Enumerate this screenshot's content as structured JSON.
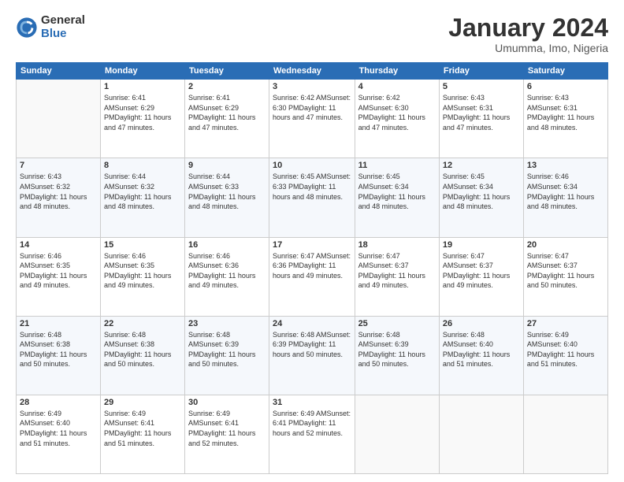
{
  "logo": {
    "general": "General",
    "blue": "Blue"
  },
  "title": {
    "month": "January 2024",
    "location": "Umumma, Imo, Nigeria"
  },
  "weekdays": [
    "Sunday",
    "Monday",
    "Tuesday",
    "Wednesday",
    "Thursday",
    "Friday",
    "Saturday"
  ],
  "weeks": [
    [
      {
        "day": "",
        "sunrise": "",
        "sunset": "",
        "daylight": ""
      },
      {
        "day": "1",
        "sunrise": "Sunrise: 6:41 AM",
        "sunset": "Sunset: 6:29 PM",
        "daylight": "Daylight: 11 hours and 47 minutes."
      },
      {
        "day": "2",
        "sunrise": "Sunrise: 6:41 AM",
        "sunset": "Sunset: 6:29 PM",
        "daylight": "Daylight: 11 hours and 47 minutes."
      },
      {
        "day": "3",
        "sunrise": "Sunrise: 6:42 AM",
        "sunset": "Sunset: 6:30 PM",
        "daylight": "Daylight: 11 hours and 47 minutes."
      },
      {
        "day": "4",
        "sunrise": "Sunrise: 6:42 AM",
        "sunset": "Sunset: 6:30 PM",
        "daylight": "Daylight: 11 hours and 47 minutes."
      },
      {
        "day": "5",
        "sunrise": "Sunrise: 6:43 AM",
        "sunset": "Sunset: 6:31 PM",
        "daylight": "Daylight: 11 hours and 47 minutes."
      },
      {
        "day": "6",
        "sunrise": "Sunrise: 6:43 AM",
        "sunset": "Sunset: 6:31 PM",
        "daylight": "Daylight: 11 hours and 48 minutes."
      }
    ],
    [
      {
        "day": "7",
        "sunrise": "Sunrise: 6:43 AM",
        "sunset": "Sunset: 6:32 PM",
        "daylight": "Daylight: 11 hours and 48 minutes."
      },
      {
        "day": "8",
        "sunrise": "Sunrise: 6:44 AM",
        "sunset": "Sunset: 6:32 PM",
        "daylight": "Daylight: 11 hours and 48 minutes."
      },
      {
        "day": "9",
        "sunrise": "Sunrise: 6:44 AM",
        "sunset": "Sunset: 6:33 PM",
        "daylight": "Daylight: 11 hours and 48 minutes."
      },
      {
        "day": "10",
        "sunrise": "Sunrise: 6:45 AM",
        "sunset": "Sunset: 6:33 PM",
        "daylight": "Daylight: 11 hours and 48 minutes."
      },
      {
        "day": "11",
        "sunrise": "Sunrise: 6:45 AM",
        "sunset": "Sunset: 6:34 PM",
        "daylight": "Daylight: 11 hours and 48 minutes."
      },
      {
        "day": "12",
        "sunrise": "Sunrise: 6:45 AM",
        "sunset": "Sunset: 6:34 PM",
        "daylight": "Daylight: 11 hours and 48 minutes."
      },
      {
        "day": "13",
        "sunrise": "Sunrise: 6:46 AM",
        "sunset": "Sunset: 6:34 PM",
        "daylight": "Daylight: 11 hours and 48 minutes."
      }
    ],
    [
      {
        "day": "14",
        "sunrise": "Sunrise: 6:46 AM",
        "sunset": "Sunset: 6:35 PM",
        "daylight": "Daylight: 11 hours and 49 minutes."
      },
      {
        "day": "15",
        "sunrise": "Sunrise: 6:46 AM",
        "sunset": "Sunset: 6:35 PM",
        "daylight": "Daylight: 11 hours and 49 minutes."
      },
      {
        "day": "16",
        "sunrise": "Sunrise: 6:46 AM",
        "sunset": "Sunset: 6:36 PM",
        "daylight": "Daylight: 11 hours and 49 minutes."
      },
      {
        "day": "17",
        "sunrise": "Sunrise: 6:47 AM",
        "sunset": "Sunset: 6:36 PM",
        "daylight": "Daylight: 11 hours and 49 minutes."
      },
      {
        "day": "18",
        "sunrise": "Sunrise: 6:47 AM",
        "sunset": "Sunset: 6:37 PM",
        "daylight": "Daylight: 11 hours and 49 minutes."
      },
      {
        "day": "19",
        "sunrise": "Sunrise: 6:47 AM",
        "sunset": "Sunset: 6:37 PM",
        "daylight": "Daylight: 11 hours and 49 minutes."
      },
      {
        "day": "20",
        "sunrise": "Sunrise: 6:47 AM",
        "sunset": "Sunset: 6:37 PM",
        "daylight": "Daylight: 11 hours and 50 minutes."
      }
    ],
    [
      {
        "day": "21",
        "sunrise": "Sunrise: 6:48 AM",
        "sunset": "Sunset: 6:38 PM",
        "daylight": "Daylight: 11 hours and 50 minutes."
      },
      {
        "day": "22",
        "sunrise": "Sunrise: 6:48 AM",
        "sunset": "Sunset: 6:38 PM",
        "daylight": "Daylight: 11 hours and 50 minutes."
      },
      {
        "day": "23",
        "sunrise": "Sunrise: 6:48 AM",
        "sunset": "Sunset: 6:39 PM",
        "daylight": "Daylight: 11 hours and 50 minutes."
      },
      {
        "day": "24",
        "sunrise": "Sunrise: 6:48 AM",
        "sunset": "Sunset: 6:39 PM",
        "daylight": "Daylight: 11 hours and 50 minutes."
      },
      {
        "day": "25",
        "sunrise": "Sunrise: 6:48 AM",
        "sunset": "Sunset: 6:39 PM",
        "daylight": "Daylight: 11 hours and 50 minutes."
      },
      {
        "day": "26",
        "sunrise": "Sunrise: 6:48 AM",
        "sunset": "Sunset: 6:40 PM",
        "daylight": "Daylight: 11 hours and 51 minutes."
      },
      {
        "day": "27",
        "sunrise": "Sunrise: 6:49 AM",
        "sunset": "Sunset: 6:40 PM",
        "daylight": "Daylight: 11 hours and 51 minutes."
      }
    ],
    [
      {
        "day": "28",
        "sunrise": "Sunrise: 6:49 AM",
        "sunset": "Sunset: 6:40 PM",
        "daylight": "Daylight: 11 hours and 51 minutes."
      },
      {
        "day": "29",
        "sunrise": "Sunrise: 6:49 AM",
        "sunset": "Sunset: 6:41 PM",
        "daylight": "Daylight: 11 hours and 51 minutes."
      },
      {
        "day": "30",
        "sunrise": "Sunrise: 6:49 AM",
        "sunset": "Sunset: 6:41 PM",
        "daylight": "Daylight: 11 hours and 52 minutes."
      },
      {
        "day": "31",
        "sunrise": "Sunrise: 6:49 AM",
        "sunset": "Sunset: 6:41 PM",
        "daylight": "Daylight: 11 hours and 52 minutes."
      },
      {
        "day": "",
        "sunrise": "",
        "sunset": "",
        "daylight": ""
      },
      {
        "day": "",
        "sunrise": "",
        "sunset": "",
        "daylight": ""
      },
      {
        "day": "",
        "sunrise": "",
        "sunset": "",
        "daylight": ""
      }
    ]
  ]
}
